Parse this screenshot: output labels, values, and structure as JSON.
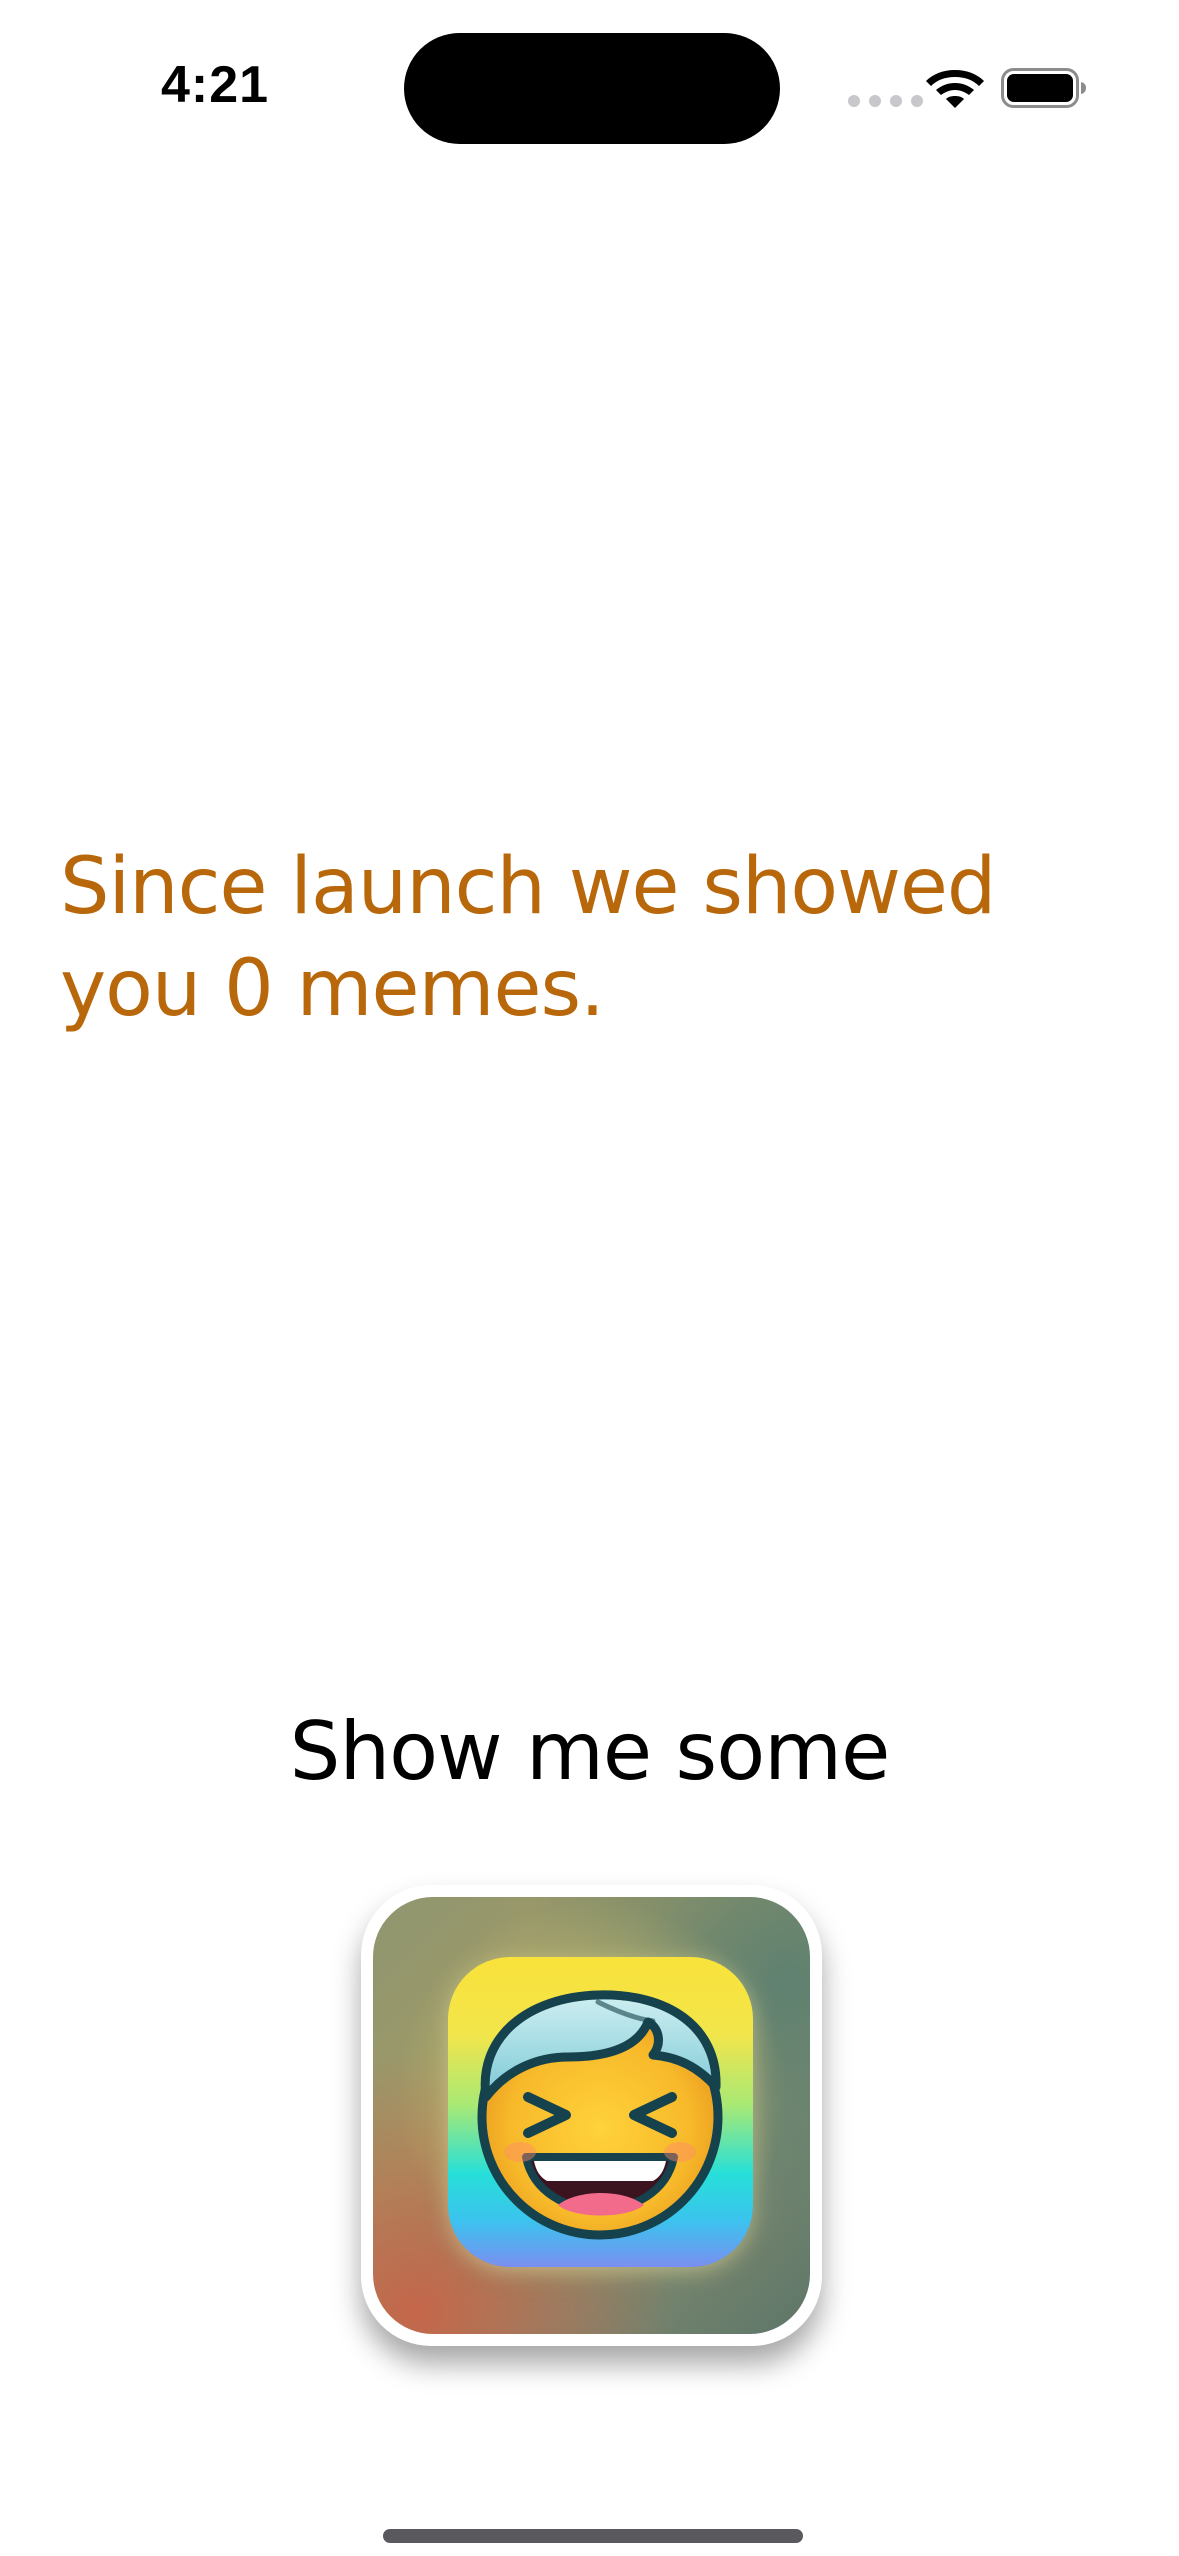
{
  "status_bar": {
    "time": "4:21"
  },
  "message": {
    "text": "Since launch we showed you 0 memes.",
    "color": "#b8670a"
  },
  "cta": {
    "label": "Show me some"
  },
  "icons": {
    "wifi": "wifi-icon",
    "battery": "battery-icon",
    "app": "laughing-face-icon"
  }
}
